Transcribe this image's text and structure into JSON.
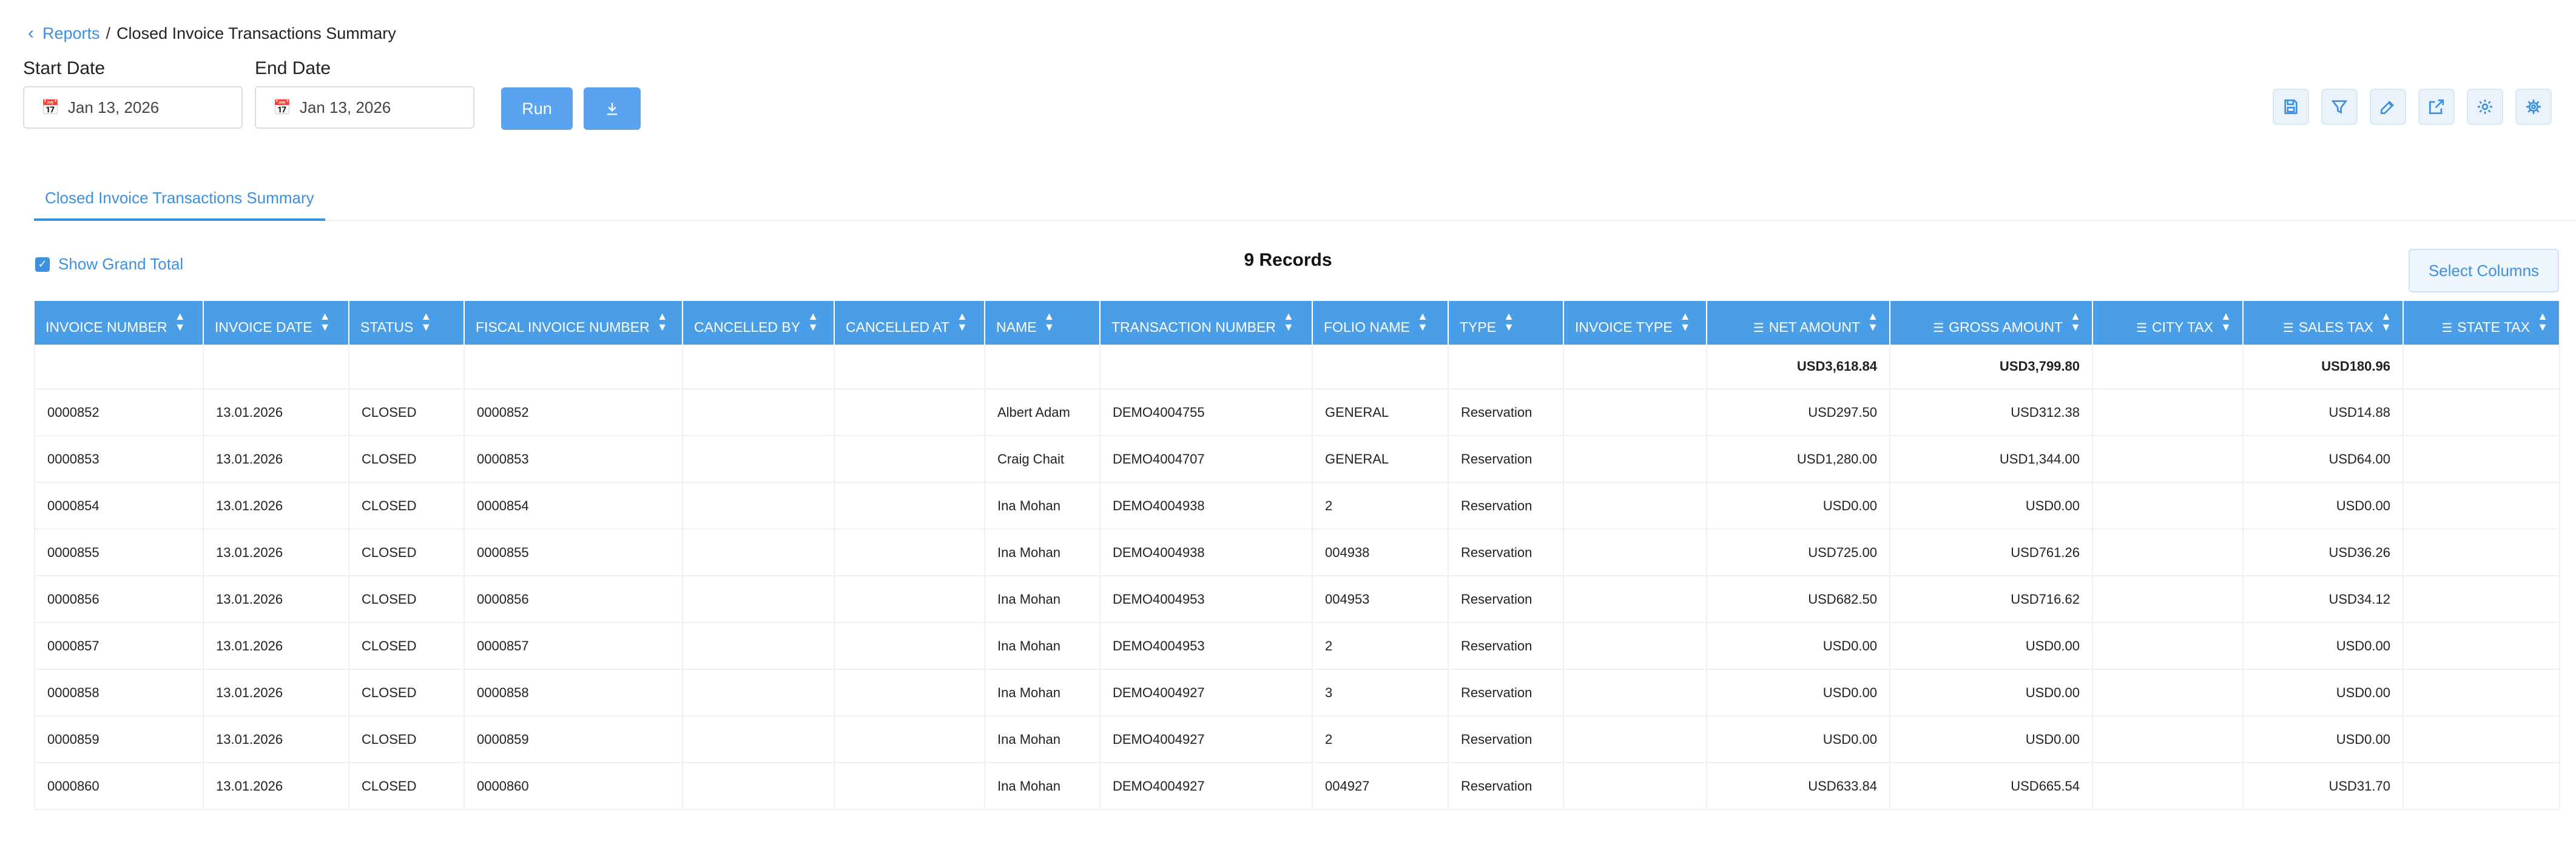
{
  "breadcrumb": {
    "parent": "Reports",
    "separator": "/",
    "current": "Closed Invoice Transactions Summary"
  },
  "filters": {
    "start_label": "Start Date",
    "start_value": "Jan 13, 2026",
    "end_label": "End Date",
    "end_value": "Jan 13, 2026",
    "run_label": "Run",
    "download_icon": "download-icon"
  },
  "toolbar_icons": [
    "save-icon",
    "filter-icon",
    "edit-icon",
    "export-icon",
    "settings-icon",
    "advanced-settings-icon"
  ],
  "tab": {
    "label": "Closed Invoice Transactions Summary"
  },
  "grand_total": {
    "label": "Show Grand Total",
    "checked": true
  },
  "records": {
    "label": "9 Records"
  },
  "select_columns": {
    "label": "Select Columns"
  },
  "colors": {
    "accent": "#4a9ee8",
    "link": "#3d8fe0"
  },
  "table": {
    "columns": [
      "INVOICE NUMBER",
      "INVOICE DATE",
      "STATUS",
      "FISCAL INVOICE NUMBER",
      "CANCELLED BY",
      "CANCELLED AT",
      "NAME",
      "TRANSACTION NUMBER",
      "FOLIO NAME",
      "TYPE",
      "INVOICE TYPE",
      "NET AMOUNT",
      "GROSS AMOUNT",
      "CITY TAX",
      "SALES TAX",
      "STATE TAX"
    ],
    "totals": [
      "",
      "",
      "",
      "",
      "",
      "",
      "",
      "",
      "",
      "",
      "",
      "USD3,618.84",
      "USD3,799.80",
      "",
      "USD180.96",
      ""
    ],
    "rows": [
      [
        "0000852",
        "13.01.2026",
        "CLOSED",
        "0000852",
        "",
        "",
        "Albert Adam",
        "DEMO4004755",
        "GENERAL",
        "Reservation",
        "",
        "USD297.50",
        "USD312.38",
        "",
        "USD14.88",
        ""
      ],
      [
        "0000853",
        "13.01.2026",
        "CLOSED",
        "0000853",
        "",
        "",
        "Craig Chait",
        "DEMO4004707",
        "GENERAL",
        "Reservation",
        "",
        "USD1,280.00",
        "USD1,344.00",
        "",
        "USD64.00",
        ""
      ],
      [
        "0000854",
        "13.01.2026",
        "CLOSED",
        "0000854",
        "",
        "",
        "Ina Mohan",
        "DEMO4004938",
        "2",
        "Reservation",
        "",
        "USD0.00",
        "USD0.00",
        "",
        "USD0.00",
        ""
      ],
      [
        "0000855",
        "13.01.2026",
        "CLOSED",
        "0000855",
        "",
        "",
        "Ina Mohan",
        "DEMO4004938",
        "004938",
        "Reservation",
        "",
        "USD725.00",
        "USD761.26",
        "",
        "USD36.26",
        ""
      ],
      [
        "0000856",
        "13.01.2026",
        "CLOSED",
        "0000856",
        "",
        "",
        "Ina Mohan",
        "DEMO4004953",
        "004953",
        "Reservation",
        "",
        "USD682.50",
        "USD716.62",
        "",
        "USD34.12",
        ""
      ],
      [
        "0000857",
        "13.01.2026",
        "CLOSED",
        "0000857",
        "",
        "",
        "Ina Mohan",
        "DEMO4004953",
        "2",
        "Reservation",
        "",
        "USD0.00",
        "USD0.00",
        "",
        "USD0.00",
        ""
      ],
      [
        "0000858",
        "13.01.2026",
        "CLOSED",
        "0000858",
        "",
        "",
        "Ina Mohan",
        "DEMO4004927",
        "3",
        "Reservation",
        "",
        "USD0.00",
        "USD0.00",
        "",
        "USD0.00",
        ""
      ],
      [
        "0000859",
        "13.01.2026",
        "CLOSED",
        "0000859",
        "",
        "",
        "Ina Mohan",
        "DEMO4004927",
        "2",
        "Reservation",
        "",
        "USD0.00",
        "USD0.00",
        "",
        "USD0.00",
        ""
      ],
      [
        "0000860",
        "13.01.2026",
        "CLOSED",
        "0000860",
        "",
        "",
        "Ina Mohan",
        "DEMO4004927",
        "004927",
        "Reservation",
        "",
        "USD633.84",
        "USD665.54",
        "",
        "USD31.70",
        ""
      ]
    ]
  }
}
